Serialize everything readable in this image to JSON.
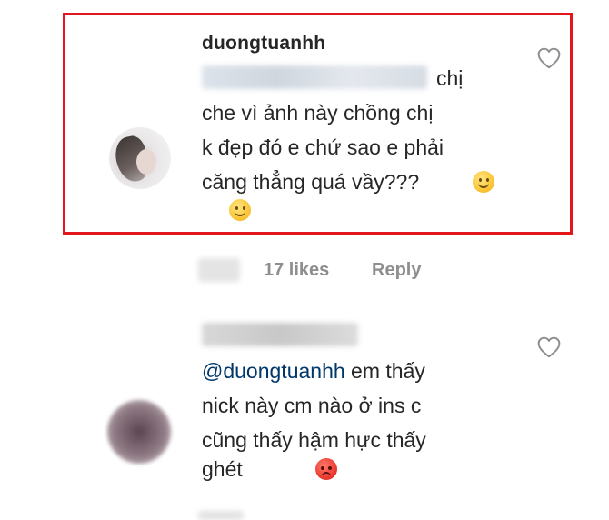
{
  "comments": [
    {
      "username": "duongtuanhh",
      "text_lines": [
        "chị",
        "che vì ảnh này chồng chị",
        "k đẹp đó e chứ sao e phải",
        "căng thẳng quá vầy???"
      ],
      "emoji_1": "slightly-smiling-face",
      "emoji_2": "slightly-smiling-face",
      "likes": "17 likes",
      "reply": "Reply"
    },
    {
      "mention": "@duongtuanhh",
      "text_lines": [
        "em thấy",
        "nick này cm nào ở ins c",
        "cũng thấy hậm hực thấy",
        "ghét"
      ],
      "emoji": "angry-face"
    }
  ],
  "icons": [
    "heart-outline-icon",
    "heart-outline-icon"
  ],
  "colors": {
    "highlight_border": "#e3161b",
    "text": "#262626",
    "mention": "#00376b",
    "meta_gray": "#8e8e8e"
  }
}
